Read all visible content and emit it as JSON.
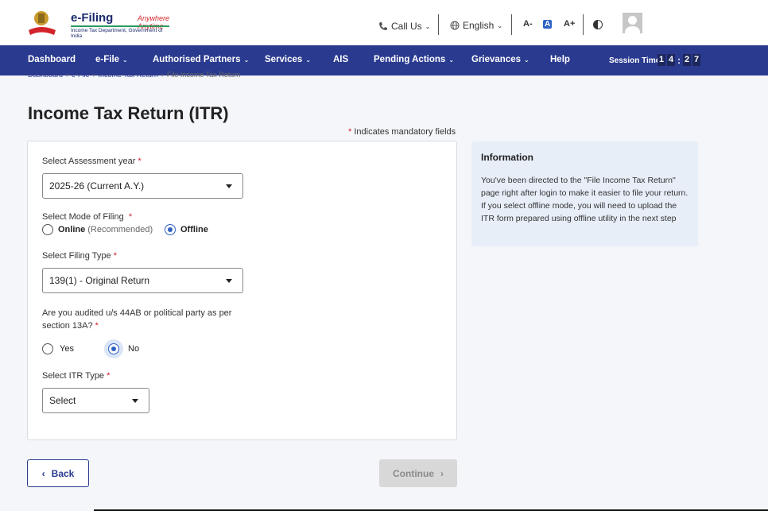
{
  "header": {
    "logo_title": "e-Filing",
    "logo_tagline": "Anywhere Anytime",
    "logo_subtitle": "Income Tax Department, Government of India",
    "call_us": "Call Us",
    "language": "English",
    "font_decrease": "A-",
    "font_normal": "A",
    "font_increase": "A+"
  },
  "nav": {
    "items": [
      {
        "label": "Dashboard"
      },
      {
        "label": "e-File"
      },
      {
        "label": "Authorised Partners"
      },
      {
        "label": "Services"
      },
      {
        "label": "AIS"
      },
      {
        "label": "Pending Actions"
      },
      {
        "label": "Grievances"
      },
      {
        "label": "Help"
      }
    ],
    "session_label": "Session Time",
    "session_digits": [
      "1",
      "4",
      "2",
      "7"
    ]
  },
  "breadcrumb": [
    "Dashboard",
    "e-File",
    "Income Tax Return",
    "File Income Tax Return"
  ],
  "page": {
    "title": "Income Tax Return (ITR)",
    "mandatory_note": "Indicates mandatory fields",
    "required_mark": "*"
  },
  "form": {
    "assessment_year": {
      "label": "Select Assessment year",
      "value": "2025-26  (Current A.Y.)"
    },
    "filing_mode": {
      "label": "Select Mode of Filing",
      "online_label": "Online",
      "online_note": "(Recommended)",
      "offline_label": "Offline",
      "selected": "Offline"
    },
    "filing_type": {
      "label": "Select Filing Type",
      "value": "139(1) - Original Return"
    },
    "audited": {
      "label_line1": "Are you audited u/s 44AB or political party as per",
      "label_line2": "section 13A?",
      "yes_label": "Yes",
      "no_label": "No",
      "selected": "No"
    },
    "itr_type": {
      "label": "Select ITR Type",
      "value": "Select"
    }
  },
  "info": {
    "title": "Information",
    "line1": "You've been directed to the \"File Income Tax Return\" page right after login to make it easier to file your return.",
    "line2": "If you select offline mode, you will need to upload the ITR form prepared using offline utility in the next step"
  },
  "buttons": {
    "back": "Back",
    "continue": "Continue"
  },
  "colors": {
    "nav_bg": "#2a3a8f",
    "accent": "#2f61c3",
    "required": "#d2232a",
    "info_bg": "#e7eef8"
  }
}
